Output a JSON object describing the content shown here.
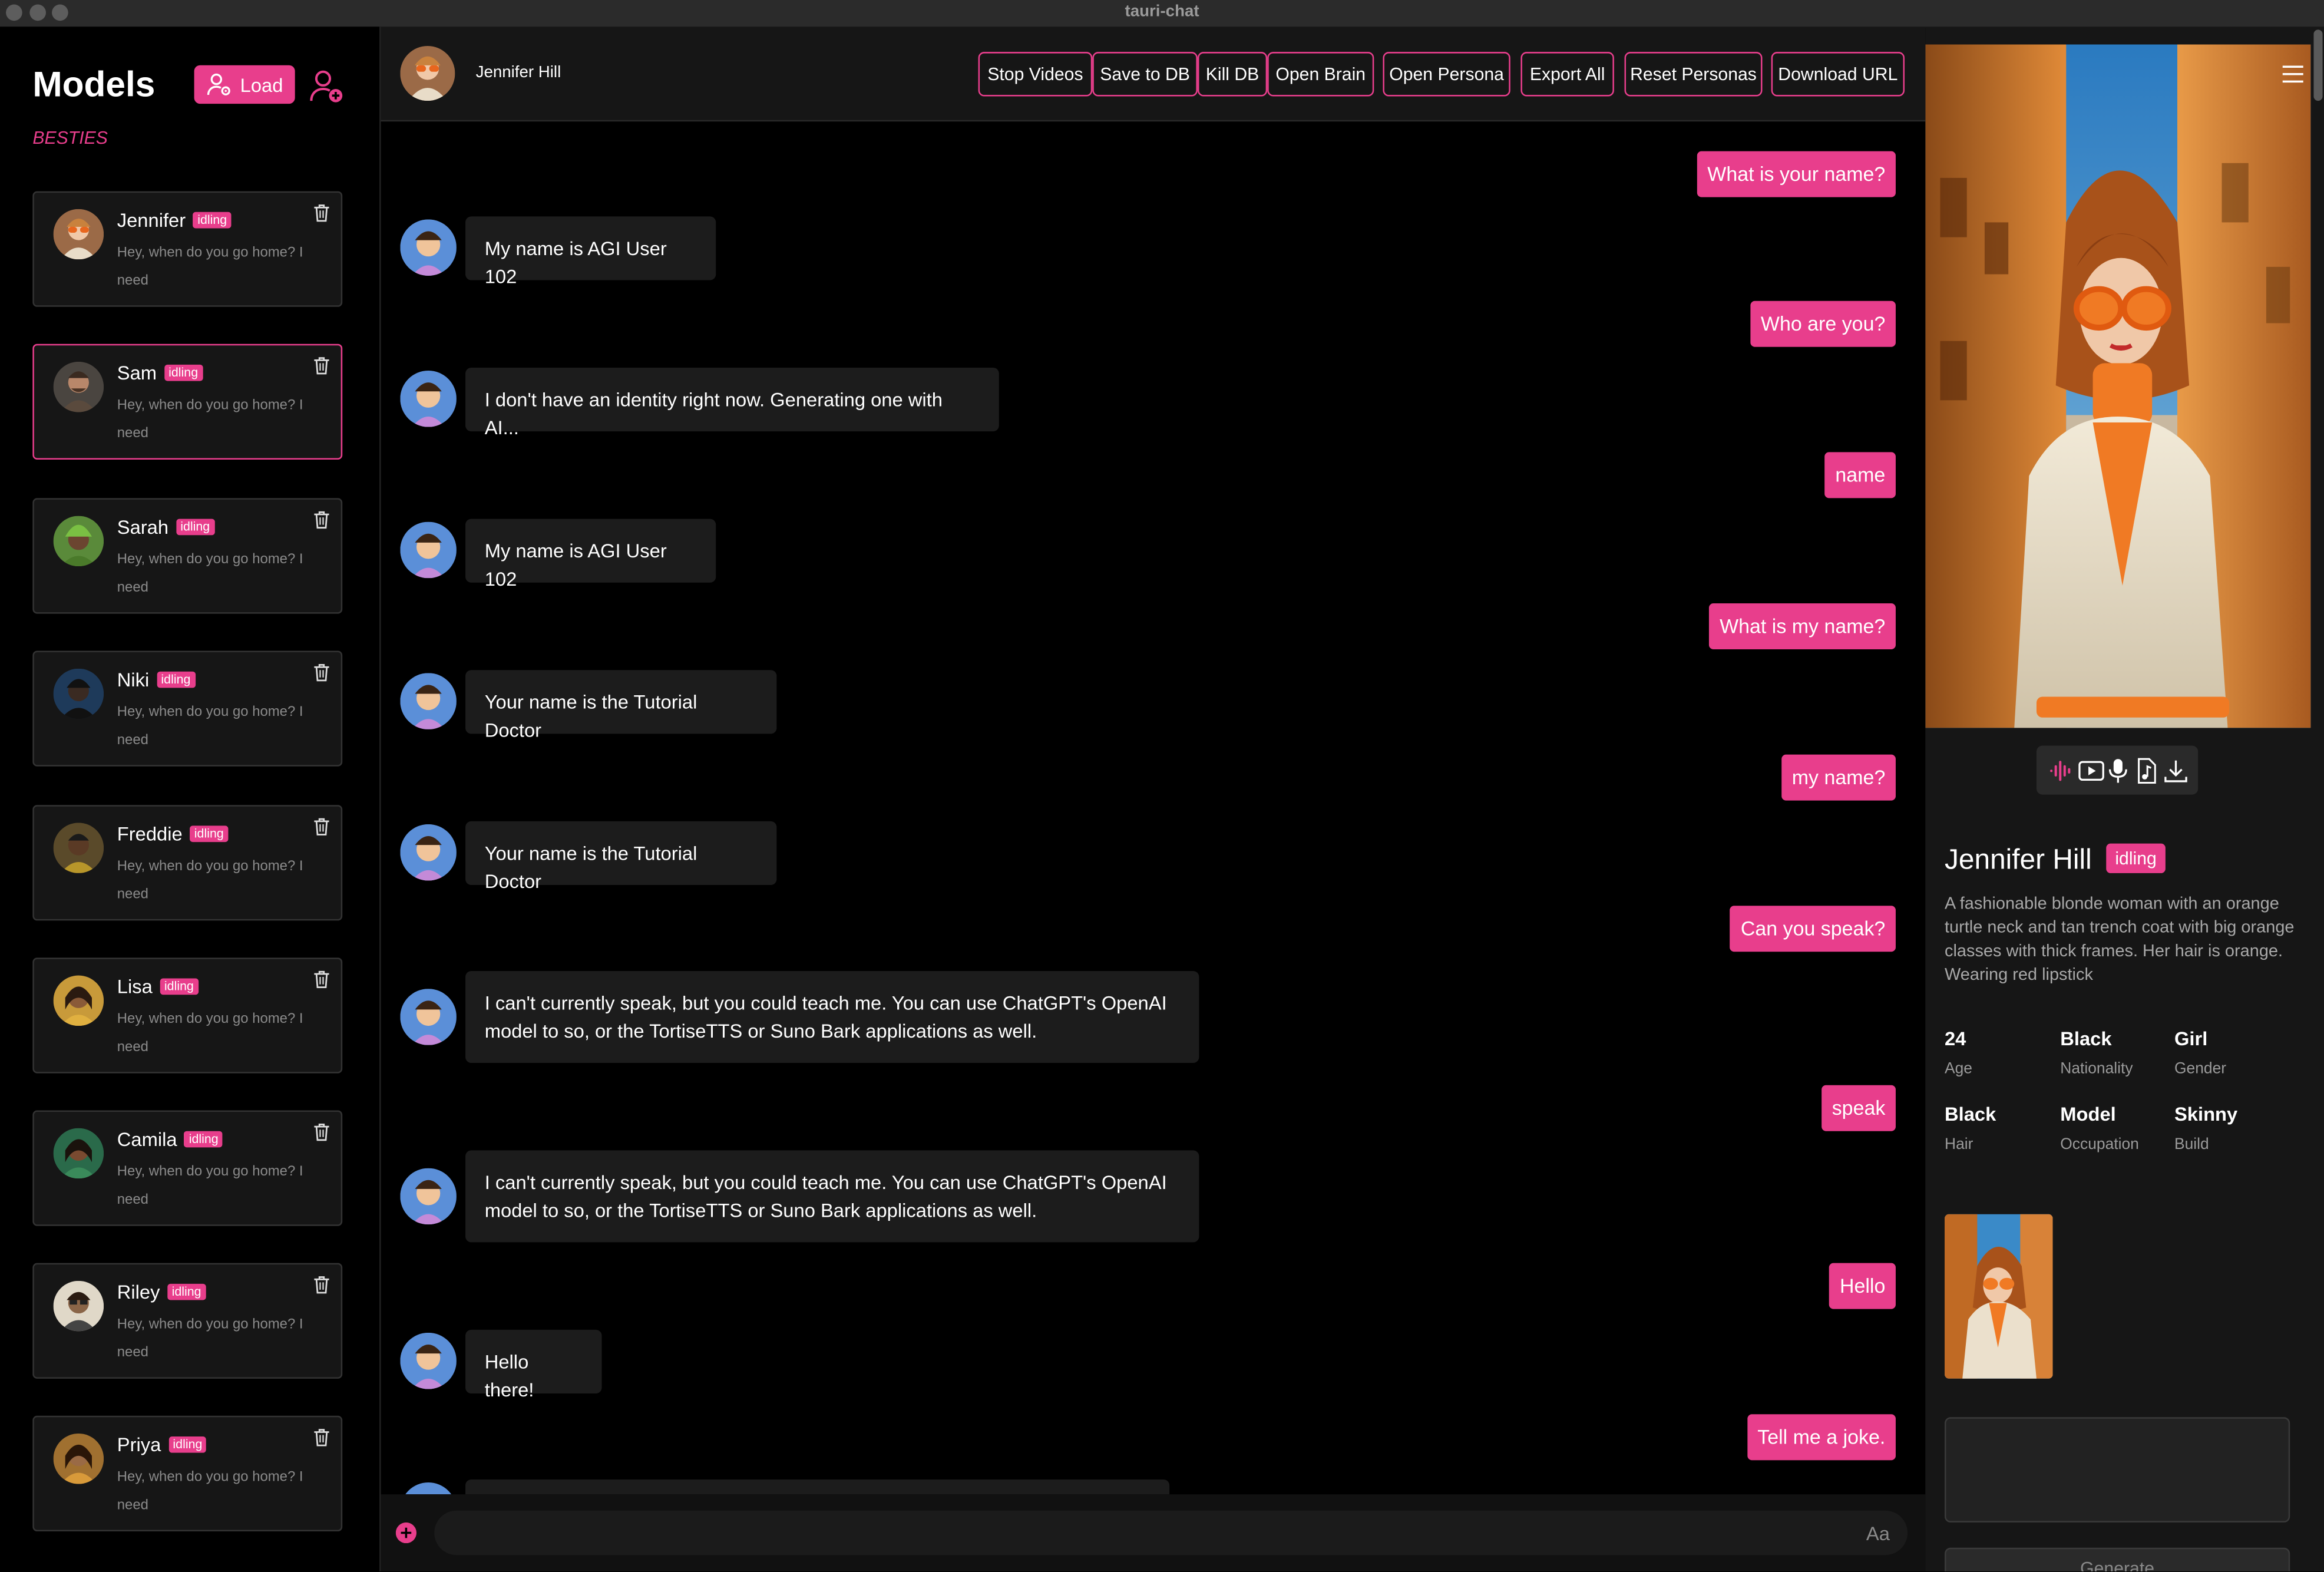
{
  "window": {
    "title": "tauri-chat"
  },
  "sidebar": {
    "title": "Models",
    "load_label": "Load",
    "section_label": "BESTIES",
    "badge": "idling",
    "preview": "Hey, when do you go home? I need",
    "models": [
      {
        "name": "Jennifer"
      },
      {
        "name": "Sam"
      },
      {
        "name": "Sarah"
      },
      {
        "name": "Niki"
      },
      {
        "name": "Freddie"
      },
      {
        "name": "Lisa"
      },
      {
        "name": "Camila"
      },
      {
        "name": "Riley"
      },
      {
        "name": "Priya"
      }
    ]
  },
  "header": {
    "name": "Jennifer Hill",
    "buttons": [
      "Stop Videos",
      "Save to DB",
      "Kill DB",
      "Open Brain",
      "Open Persona",
      "Export All",
      "Reset Personas",
      "Download URL"
    ]
  },
  "chat": {
    "messages": [
      {
        "role": "user",
        "text": "What is your name?"
      },
      {
        "role": "bot",
        "text": "My name is AGI User 102"
      },
      {
        "role": "user",
        "text": "Who are you?"
      },
      {
        "role": "bot",
        "text": "I don't have an identity right now. Generating one with AI..."
      },
      {
        "role": "user",
        "text": "name"
      },
      {
        "role": "bot",
        "text": "My name is AGI User 102"
      },
      {
        "role": "user",
        "text": "What is my name?"
      },
      {
        "role": "bot",
        "text": "Your name is the Tutorial Doctor"
      },
      {
        "role": "user",
        "text": "my name?"
      },
      {
        "role": "bot",
        "text": "Your name is the Tutorial Doctor"
      },
      {
        "role": "user",
        "text": "Can you speak?"
      },
      {
        "role": "bot",
        "text": "I can't currently speak, but you could teach me. You can use ChatGPT's OpenAI model to so, or the TortiseTTS or Suno Bark applications as well."
      },
      {
        "role": "user",
        "text": "speak"
      },
      {
        "role": "bot",
        "text": "I can't currently speak, but you could teach me. You can use ChatGPT's OpenAI model to so, or the TortiseTTS or Suno Bark applications as well."
      },
      {
        "role": "user",
        "text": "Hello"
      },
      {
        "role": "bot",
        "text": "Hello there!"
      },
      {
        "role": "user",
        "text": "Tell me a joke."
      }
    ],
    "input_hint": "Aa"
  },
  "persona": {
    "name": "Jennifer Hill",
    "status": "idling",
    "description": "A fashionable blonde woman with an orange turtle neck and tan trench coat with big orange classes with thick frames. Her hair is orange. Wearing red lipstick",
    "stats": [
      {
        "value": "24",
        "label": "Age"
      },
      {
        "value": "Black",
        "label": "Nationality"
      },
      {
        "value": "Girl",
        "label": "Gender"
      },
      {
        "value": "Black",
        "label": "Hair"
      },
      {
        "value": "Model",
        "label": "Occupation"
      },
      {
        "value": "Skinny",
        "label": "Build"
      }
    ],
    "generate_label": "Generate"
  },
  "colors": {
    "accent": "#e83e8c",
    "panel": "#161616",
    "background": "#000000"
  }
}
